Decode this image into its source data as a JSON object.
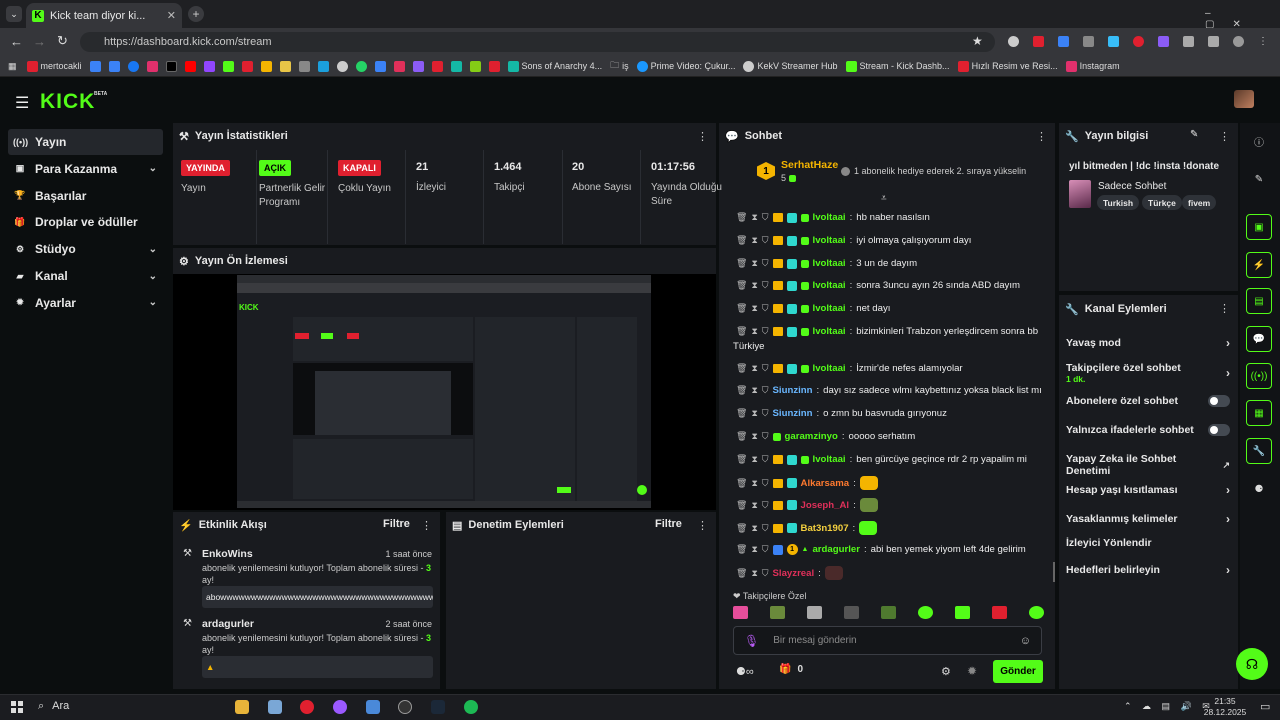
{
  "browser": {
    "tab_title": "Kick team diyor ki...",
    "url": "https://dashboard.kick.com/stream",
    "bookmarks": [
      "mertocakli",
      "Sons of Anarchy 4...",
      "iş",
      "Prime Video: Çukur...",
      "KekV Streamer Hub",
      "Stream - Kick Dashb...",
      "Hızlı Resim ve Resi...",
      "Instagram"
    ]
  },
  "app": {
    "logo": "KICK",
    "beta": "BETA"
  },
  "sidebar": {
    "items": [
      {
        "label": "Yayın",
        "icon": "broadcast-icon"
      },
      {
        "label": "Para Kazanma",
        "icon": "money-icon"
      },
      {
        "label": "Başarılar",
        "icon": "trophy-icon"
      },
      {
        "label": "Droplar ve ödüller",
        "icon": "gift-icon"
      },
      {
        "label": "Stüdyo",
        "icon": "gear-icon"
      },
      {
        "label": "Kanal",
        "icon": "channel-icon"
      },
      {
        "label": "Ayarlar",
        "icon": "settings-icon"
      }
    ]
  },
  "stats": {
    "title": "Yayın İstatistikleri",
    "badges": [
      {
        "badge": "YAYINDA",
        "label": "Yayın",
        "color": "#e0202f"
      },
      {
        "badge": "AÇIK",
        "label": "Partnerlik Gelir Programı",
        "color": "#53fc18"
      },
      {
        "badge": "KAPALI",
        "label": "Çoklu Yayın",
        "color": "#e0202f"
      }
    ],
    "numbers": [
      {
        "value": "21",
        "label": "İzleyici"
      },
      {
        "value": "1.464",
        "label": "Takipçi"
      },
      {
        "value": "20",
        "label": "Abone Sayısı"
      },
      {
        "value": "01:17:56",
        "label": "Yayında Olduğu Süre"
      }
    ]
  },
  "preview": {
    "title": "Yayın Ön İzlemesi"
  },
  "activity": {
    "title": "Etkinlik Akışı",
    "filter": "Filtre",
    "events": [
      {
        "user": "EnkoWins",
        "time": "1 saat önce",
        "text": "abonelik yenilemesini kutluyor! Toplam abonelik süresi - ",
        "months": "3",
        "unit": "ay!",
        "message": "abowwwwwwwwwwwwwwwwwwwwwwwwwwwwwwwwwwwwwwww"
      },
      {
        "user": "ardagurler",
        "time": "2 saat önce",
        "text": "abonelik yenilemesini kutluyor! Toplam abonelik süresi - ",
        "months": "3",
        "unit": "ay!",
        "message": "▲"
      }
    ]
  },
  "moderation": {
    "title": "Denetim Eylemleri",
    "filter": "Filtre"
  },
  "chat": {
    "title": "Sohbet",
    "pinned_user": "SerhatHaze",
    "pinned_count": "5",
    "pinned_rank": "1",
    "pinned_text": "1 abonelik hediye ederek 2. sıraya yükselin",
    "messages": [
      {
        "user": "Ivoltaai",
        "color": "#53fc18",
        "text": "hb naber nasılsın"
      },
      {
        "user": "Ivoltaai",
        "color": "#53fc18",
        "text": "iyi olmaya çalışıyorum dayı"
      },
      {
        "user": "Ivoltaai",
        "color": "#53fc18",
        "text": "3 un de dayım"
      },
      {
        "user": "Ivoltaai",
        "color": "#53fc18",
        "text": "sonra 3uncu ayın 26 sında ABD dayım"
      },
      {
        "user": "Ivoltaai",
        "color": "#53fc18",
        "text": "net dayı"
      },
      {
        "user": "Ivoltaai",
        "color": "#53fc18",
        "text": "bizimkinleri Trabzon yerleşdircem sonra bb",
        "cont": "Türkiye"
      },
      {
        "user": "Ivoltaai",
        "color": "#53fc18",
        "text": "İzmir'de nefes alamıyolar"
      },
      {
        "user": "Siunzinn",
        "color": "#6ab7ff",
        "text": "dayı sız sadece wlmı kaybettınız yoksa black list mı"
      },
      {
        "user": "Siunzinn",
        "color": "#6ab7ff",
        "text": "o zmn bu basvruda gırıyonuz"
      },
      {
        "user": "garamzinyo",
        "color": "#53fc18",
        "text": "ooooo serhatım"
      },
      {
        "user": "Ivoltaai",
        "color": "#53fc18",
        "text": "ben gürcüye geçince rdr 2 rp yapalim mi"
      },
      {
        "user": "Alkarsama",
        "color": "#ff7a2f",
        "text": ""
      },
      {
        "user": "Joseph_Al",
        "color": "#e0305a",
        "text": ""
      },
      {
        "user": "Bat3n1907",
        "color": "#f4d03f",
        "text": ""
      },
      {
        "user": "ardagurler",
        "color": "#53fc18",
        "text": "abi ben yemek yiyom left 4de gelirim"
      },
      {
        "user": "Slayzreal",
        "color": "#e0305a",
        "text": ""
      }
    ],
    "followers_only": "Takipçilere Özel",
    "input_placeholder": "Bir mesaj gönderin",
    "send": "Gönder",
    "points": "0"
  },
  "info": {
    "title": "Yayın bilgisi",
    "stream_title": "yıl bitmeden | !dc !insta !donate",
    "category": "Sadece Sohbet",
    "tags": [
      "Turkish",
      "Türkçe",
      "fivem"
    ]
  },
  "actions": {
    "title": "Kanal Eylemleri",
    "items": [
      {
        "label": "Yavaş mod",
        "type": "chevron"
      },
      {
        "label": "Takipçilere özel sohbet",
        "sub": "1 dk.",
        "type": "chevron"
      },
      {
        "label": "Abonelere özel sohbet",
        "type": "toggle"
      },
      {
        "label": "Yalnızca ifadelerle sohbet",
        "type": "toggle"
      },
      {
        "label": "Yapay Zeka ile Sohbet Denetimi",
        "type": "external"
      },
      {
        "label": "Hesap yaşı kısıtlaması",
        "type": "chevron"
      },
      {
        "label": "Yasaklanmış kelimeler",
        "type": "chevron"
      },
      {
        "label": "İzleyici Yönlendir",
        "type": "none"
      },
      {
        "label": "Hedefleri belirleyin",
        "type": "chevron"
      }
    ]
  },
  "taskbar": {
    "search": "Ara",
    "time": "21:35",
    "date": "28.12.2025"
  }
}
